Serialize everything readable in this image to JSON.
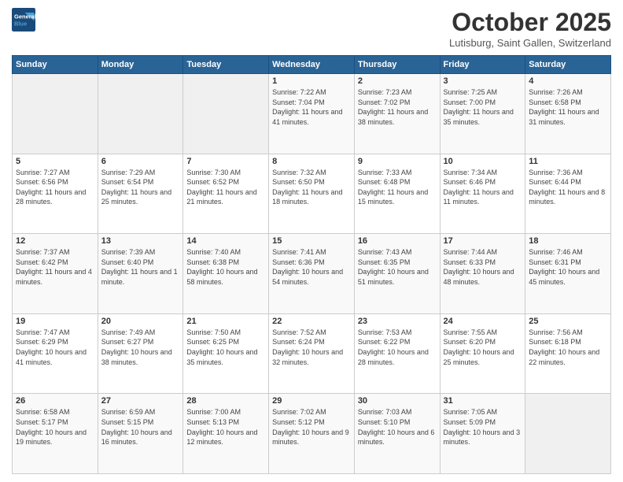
{
  "header": {
    "logo_line1": "General",
    "logo_line2": "Blue",
    "month_title": "October 2025",
    "location": "Lutisburg, Saint Gallen, Switzerland"
  },
  "weekdays": [
    "Sunday",
    "Monday",
    "Tuesday",
    "Wednesday",
    "Thursday",
    "Friday",
    "Saturday"
  ],
  "weeks": [
    [
      {
        "day": "",
        "info": ""
      },
      {
        "day": "",
        "info": ""
      },
      {
        "day": "",
        "info": ""
      },
      {
        "day": "1",
        "info": "Sunrise: 7:22 AM\nSunset: 7:04 PM\nDaylight: 11 hours\nand 41 minutes."
      },
      {
        "day": "2",
        "info": "Sunrise: 7:23 AM\nSunset: 7:02 PM\nDaylight: 11 hours\nand 38 minutes."
      },
      {
        "day": "3",
        "info": "Sunrise: 7:25 AM\nSunset: 7:00 PM\nDaylight: 11 hours\nand 35 minutes."
      },
      {
        "day": "4",
        "info": "Sunrise: 7:26 AM\nSunset: 6:58 PM\nDaylight: 11 hours\nand 31 minutes."
      }
    ],
    [
      {
        "day": "5",
        "info": "Sunrise: 7:27 AM\nSunset: 6:56 PM\nDaylight: 11 hours\nand 28 minutes."
      },
      {
        "day": "6",
        "info": "Sunrise: 7:29 AM\nSunset: 6:54 PM\nDaylight: 11 hours\nand 25 minutes."
      },
      {
        "day": "7",
        "info": "Sunrise: 7:30 AM\nSunset: 6:52 PM\nDaylight: 11 hours\nand 21 minutes."
      },
      {
        "day": "8",
        "info": "Sunrise: 7:32 AM\nSunset: 6:50 PM\nDaylight: 11 hours\nand 18 minutes."
      },
      {
        "day": "9",
        "info": "Sunrise: 7:33 AM\nSunset: 6:48 PM\nDaylight: 11 hours\nand 15 minutes."
      },
      {
        "day": "10",
        "info": "Sunrise: 7:34 AM\nSunset: 6:46 PM\nDaylight: 11 hours\nand 11 minutes."
      },
      {
        "day": "11",
        "info": "Sunrise: 7:36 AM\nSunset: 6:44 PM\nDaylight: 11 hours\nand 8 minutes."
      }
    ],
    [
      {
        "day": "12",
        "info": "Sunrise: 7:37 AM\nSunset: 6:42 PM\nDaylight: 11 hours\nand 4 minutes."
      },
      {
        "day": "13",
        "info": "Sunrise: 7:39 AM\nSunset: 6:40 PM\nDaylight: 11 hours\nand 1 minute."
      },
      {
        "day": "14",
        "info": "Sunrise: 7:40 AM\nSunset: 6:38 PM\nDaylight: 10 hours\nand 58 minutes."
      },
      {
        "day": "15",
        "info": "Sunrise: 7:41 AM\nSunset: 6:36 PM\nDaylight: 10 hours\nand 54 minutes."
      },
      {
        "day": "16",
        "info": "Sunrise: 7:43 AM\nSunset: 6:35 PM\nDaylight: 10 hours\nand 51 minutes."
      },
      {
        "day": "17",
        "info": "Sunrise: 7:44 AM\nSunset: 6:33 PM\nDaylight: 10 hours\nand 48 minutes."
      },
      {
        "day": "18",
        "info": "Sunrise: 7:46 AM\nSunset: 6:31 PM\nDaylight: 10 hours\nand 45 minutes."
      }
    ],
    [
      {
        "day": "19",
        "info": "Sunrise: 7:47 AM\nSunset: 6:29 PM\nDaylight: 10 hours\nand 41 minutes."
      },
      {
        "day": "20",
        "info": "Sunrise: 7:49 AM\nSunset: 6:27 PM\nDaylight: 10 hours\nand 38 minutes."
      },
      {
        "day": "21",
        "info": "Sunrise: 7:50 AM\nSunset: 6:25 PM\nDaylight: 10 hours\nand 35 minutes."
      },
      {
        "day": "22",
        "info": "Sunrise: 7:52 AM\nSunset: 6:24 PM\nDaylight: 10 hours\nand 32 minutes."
      },
      {
        "day": "23",
        "info": "Sunrise: 7:53 AM\nSunset: 6:22 PM\nDaylight: 10 hours\nand 28 minutes."
      },
      {
        "day": "24",
        "info": "Sunrise: 7:55 AM\nSunset: 6:20 PM\nDaylight: 10 hours\nand 25 minutes."
      },
      {
        "day": "25",
        "info": "Sunrise: 7:56 AM\nSunset: 6:18 PM\nDaylight: 10 hours\nand 22 minutes."
      }
    ],
    [
      {
        "day": "26",
        "info": "Sunrise: 6:58 AM\nSunset: 5:17 PM\nDaylight: 10 hours\nand 19 minutes."
      },
      {
        "day": "27",
        "info": "Sunrise: 6:59 AM\nSunset: 5:15 PM\nDaylight: 10 hours\nand 16 minutes."
      },
      {
        "day": "28",
        "info": "Sunrise: 7:00 AM\nSunset: 5:13 PM\nDaylight: 10 hours\nand 12 minutes."
      },
      {
        "day": "29",
        "info": "Sunrise: 7:02 AM\nSunset: 5:12 PM\nDaylight: 10 hours\nand 9 minutes."
      },
      {
        "day": "30",
        "info": "Sunrise: 7:03 AM\nSunset: 5:10 PM\nDaylight: 10 hours\nand 6 minutes."
      },
      {
        "day": "31",
        "info": "Sunrise: 7:05 AM\nSunset: 5:09 PM\nDaylight: 10 hours\nand 3 minutes."
      },
      {
        "day": "",
        "info": ""
      }
    ]
  ]
}
